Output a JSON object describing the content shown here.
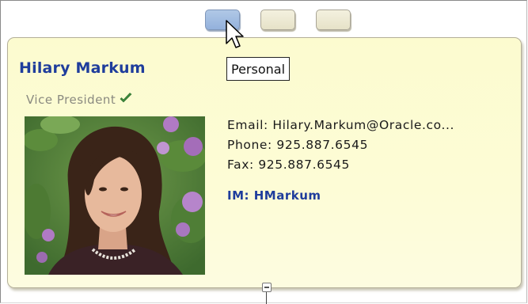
{
  "tabs": [
    {
      "state": "active"
    },
    {
      "state": "inactive"
    },
    {
      "state": "inactive"
    }
  ],
  "tooltip": {
    "text": "Personal"
  },
  "card": {
    "name": "Hilary Markum",
    "title": "Vice President",
    "status_icon": "checkmark-icon",
    "email_line": "Email: Hilary.Markum@Oracle.co...",
    "phone_line": "Phone: 925.887.6545",
    "fax_line": "Fax: 925.887.6545",
    "im_line": "IM: HMarkum"
  },
  "colors": {
    "name": "#1f3d9c",
    "check": "#3d8a3d",
    "card_bg": "#fcfbcf",
    "active_tab": "#a4bde2"
  }
}
